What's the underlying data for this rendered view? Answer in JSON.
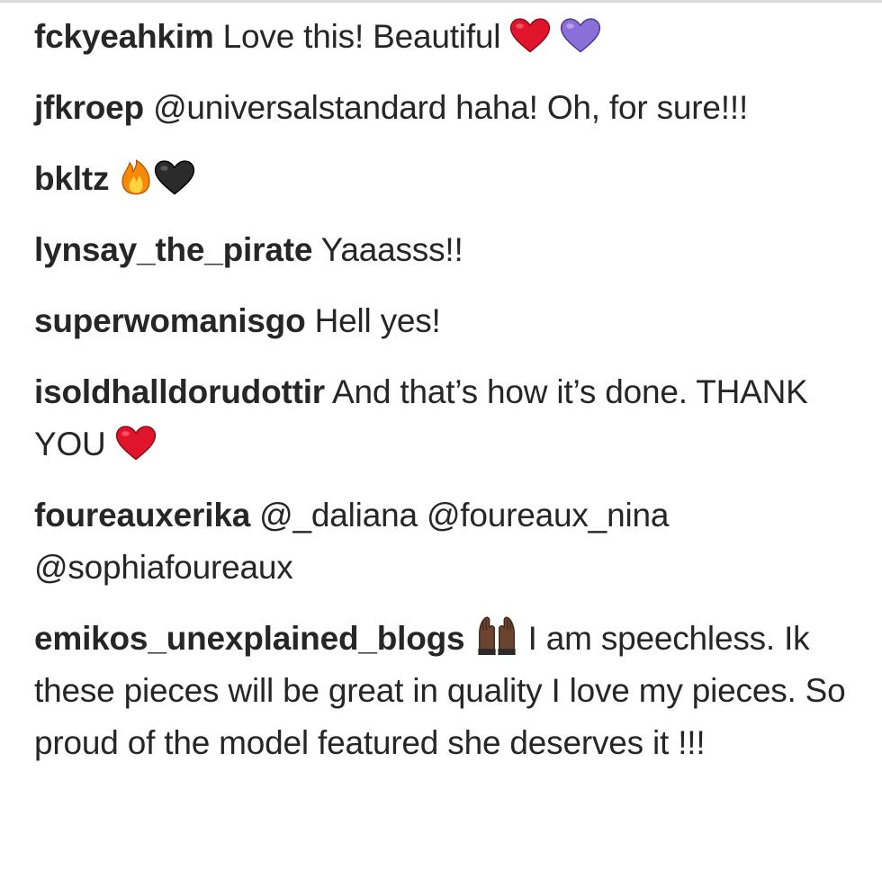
{
  "comments": [
    {
      "user": "fckyeahkim",
      "text": " Love this! Beautiful ",
      "emojis": [
        "red-heart-icon",
        "purple-heart-icon"
      ]
    },
    {
      "user": "jfkroep",
      "mention": "@universalstandard",
      "text": " haha! Oh, for sure!!!"
    },
    {
      "user": "bkltz",
      "emojis": [
        "fire-icon",
        "black-heart-icon"
      ]
    },
    {
      "user": "lynsay_the_pirate",
      "text": " Yaaasss!!"
    },
    {
      "user": "superwomanisgo",
      "text": " Hell yes!"
    },
    {
      "user": "isoldhalldorudottir",
      "text": " And that’s how it’s done. THANK YOU ",
      "emojis": [
        "red-heart-icon"
      ]
    },
    {
      "user": "foureauxerika",
      "mentions": [
        "@_daliana",
        "@foureaux_nina",
        "@sophiafoureaux"
      ]
    },
    {
      "user": "emikos_unexplained_blogs",
      "emojis": [
        "raising-hands-icon"
      ],
      "text": " I am speechless. Ik these pieces will be great in quality I love my pieces. So proud of the model featured she deserves it !!!"
    }
  ],
  "colors": {
    "text": "#262626",
    "red_heart": "#e0142a",
    "purple_heart": "#8b6fd9",
    "black_heart": "#2b2b2b",
    "fire": "#f58a07",
    "hands": "#6b4430"
  }
}
